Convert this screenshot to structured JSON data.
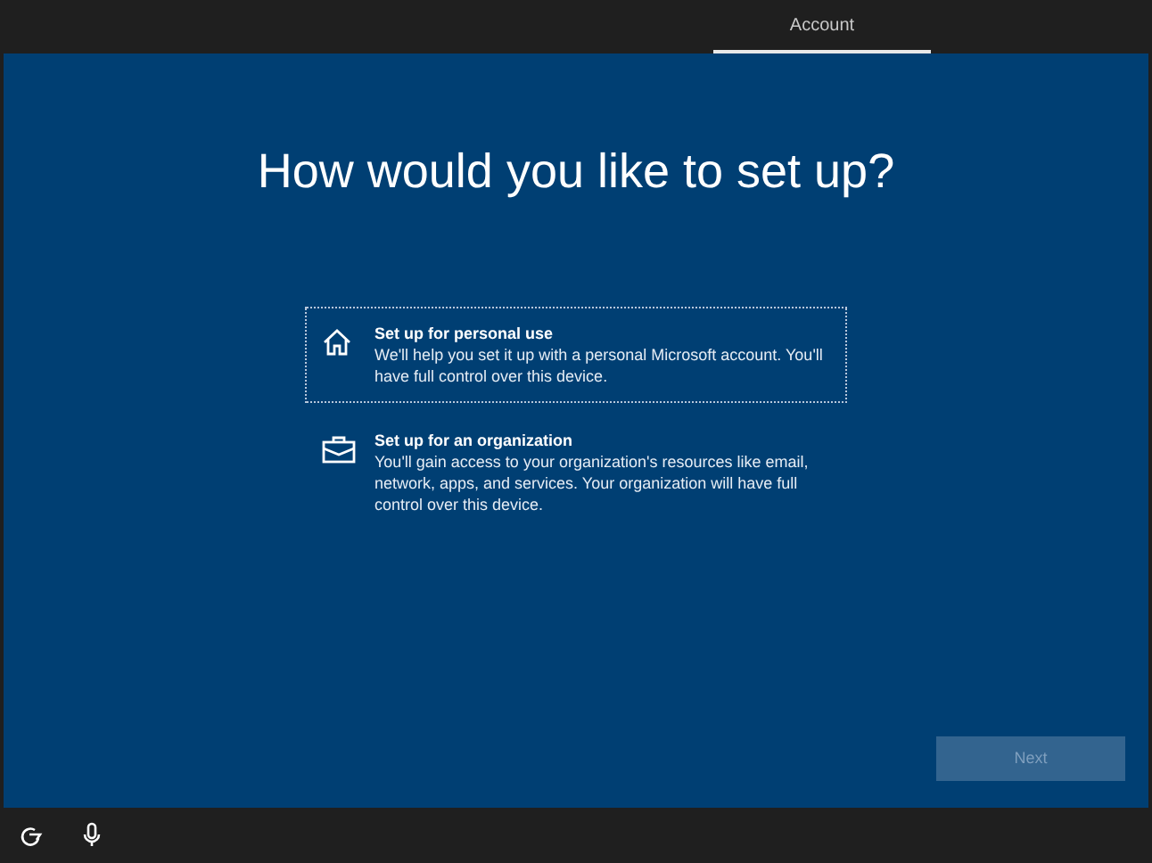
{
  "tabs": [
    {
      "label": "Account",
      "selected": true
    }
  ],
  "heading": "How would you like to set up?",
  "options": [
    {
      "kind": "home",
      "title": "Set up for personal use",
      "description": "We'll help you set it up with a personal Microsoft account. You'll have full control over this device.",
      "selected": true
    },
    {
      "kind": "organization",
      "title": "Set up for an organization",
      "description": "You'll gain access to your organization's resources like email, network, apps, and services. Your organization will have full control over this device.",
      "selected": false
    }
  ],
  "next_button": {
    "label": "Next",
    "disabled": true
  },
  "taskbar_icons": [
    {
      "kind": "accessibility"
    },
    {
      "kind": "microphone"
    }
  ]
}
